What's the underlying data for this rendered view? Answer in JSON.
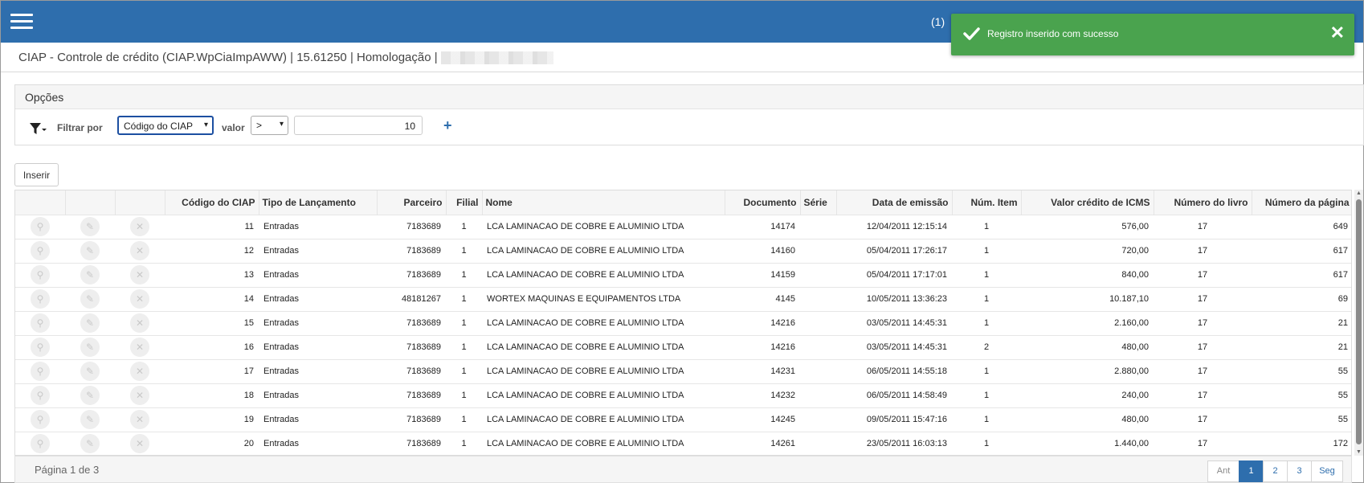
{
  "topbar": {
    "count": "(1)"
  },
  "toast": {
    "message": "Registro inserido com sucesso",
    "close": "✕",
    "color": "#4aa34e"
  },
  "header": {
    "title": "CIAP - Controle de crédito (CIAP.WpCiaImpAWW) | 15.61250 | Homologação |"
  },
  "options": {
    "title": "Opções",
    "filter_label": "Filtrar por",
    "filter_field": "Código do CIAP",
    "value_label": "valor",
    "operator": ">",
    "value": "10",
    "add": "+"
  },
  "actions": {
    "insert": "Inserir"
  },
  "columns": [
    "Código do CIAP",
    "Tipo de Lançamento",
    "Parceiro",
    "Filial",
    "Nome",
    "Documento",
    "Série",
    "Data de emissão",
    "Núm. Item",
    "Valor crédito de ICMS",
    "Número do livro",
    "Número da página"
  ],
  "rows": [
    {
      "codigo": "11",
      "tipo": "Entradas",
      "parceiro": "7183689",
      "filial": "1",
      "nome": "LCA LAMINACAO DE COBRE E ALUMINIO LTDA",
      "documento": "14174",
      "serie": "",
      "data": "12/04/2011 12:15:14",
      "item": "1",
      "valor": "576,00",
      "livro": "17",
      "pagina": "649"
    },
    {
      "codigo": "12",
      "tipo": "Entradas",
      "parceiro": "7183689",
      "filial": "1",
      "nome": "LCA LAMINACAO DE COBRE E ALUMINIO LTDA",
      "documento": "14160",
      "serie": "",
      "data": "05/04/2011 17:26:17",
      "item": "1",
      "valor": "720,00",
      "livro": "17",
      "pagina": "617"
    },
    {
      "codigo": "13",
      "tipo": "Entradas",
      "parceiro": "7183689",
      "filial": "1",
      "nome": "LCA LAMINACAO DE COBRE E ALUMINIO LTDA",
      "documento": "14159",
      "serie": "",
      "data": "05/04/2011 17:17:01",
      "item": "1",
      "valor": "840,00",
      "livro": "17",
      "pagina": "617"
    },
    {
      "codigo": "14",
      "tipo": "Entradas",
      "parceiro": "48181267",
      "filial": "1",
      "nome": "WORTEX MAQUINAS E EQUIPAMENTOS LTDA",
      "documento": "4145",
      "serie": "",
      "data": "10/05/2011 13:36:23",
      "item": "1",
      "valor": "10.187,10",
      "livro": "17",
      "pagina": "69"
    },
    {
      "codigo": "15",
      "tipo": "Entradas",
      "parceiro": "7183689",
      "filial": "1",
      "nome": "LCA LAMINACAO DE COBRE E ALUMINIO LTDA",
      "documento": "14216",
      "serie": "",
      "data": "03/05/2011 14:45:31",
      "item": "1",
      "valor": "2.160,00",
      "livro": "17",
      "pagina": "21"
    },
    {
      "codigo": "16",
      "tipo": "Entradas",
      "parceiro": "7183689",
      "filial": "1",
      "nome": "LCA LAMINACAO DE COBRE E ALUMINIO LTDA",
      "documento": "14216",
      "serie": "",
      "data": "03/05/2011 14:45:31",
      "item": "2",
      "valor": "480,00",
      "livro": "17",
      "pagina": "21"
    },
    {
      "codigo": "17",
      "tipo": "Entradas",
      "parceiro": "7183689",
      "filial": "1",
      "nome": "LCA LAMINACAO DE COBRE E ALUMINIO LTDA",
      "documento": "14231",
      "serie": "",
      "data": "06/05/2011 14:55:18",
      "item": "1",
      "valor": "2.880,00",
      "livro": "17",
      "pagina": "55"
    },
    {
      "codigo": "18",
      "tipo": "Entradas",
      "parceiro": "7183689",
      "filial": "1",
      "nome": "LCA LAMINACAO DE COBRE E ALUMINIO LTDA",
      "documento": "14232",
      "serie": "",
      "data": "06/05/2011 14:58:49",
      "item": "1",
      "valor": "240,00",
      "livro": "17",
      "pagina": "55"
    },
    {
      "codigo": "19",
      "tipo": "Entradas",
      "parceiro": "7183689",
      "filial": "1",
      "nome": "LCA LAMINACAO DE COBRE E ALUMINIO LTDA",
      "documento": "14245",
      "serie": "",
      "data": "09/05/2011 15:47:16",
      "item": "1",
      "valor": "480,00",
      "livro": "17",
      "pagina": "55"
    },
    {
      "codigo": "20",
      "tipo": "Entradas",
      "parceiro": "7183689",
      "filial": "1",
      "nome": "LCA LAMINACAO DE COBRE E ALUMINIO LTDA",
      "documento": "14261",
      "serie": "",
      "data": "23/05/2011 16:03:13",
      "item": "1",
      "valor": "1.440,00",
      "livro": "17",
      "pagina": "172"
    }
  ],
  "footer": {
    "page_info": "Página 1 de 3",
    "prev": "Ant",
    "pages": [
      "1",
      "2",
      "3"
    ],
    "next": "Seg"
  },
  "colors": {
    "topbar": "#2e6ead",
    "accent": "#2e6ead",
    "toast": "#4aa34e"
  },
  "icons": [
    "menu-icon",
    "check-icon",
    "close-icon",
    "filter-icon",
    "view-icon",
    "edit-icon",
    "delete-icon"
  ]
}
